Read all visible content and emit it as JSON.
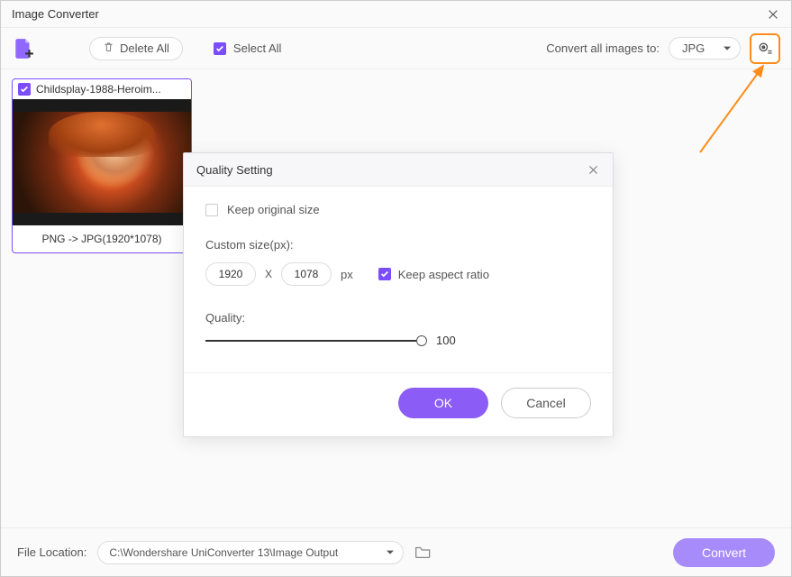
{
  "titlebar": {
    "title": "Image Converter"
  },
  "toolbar": {
    "delete_all_label": "Delete All",
    "select_all_label": "Select All",
    "convert_to_label": "Convert all images to:",
    "format_selected": "JPG"
  },
  "card": {
    "filename": "Childsplay-1988-Heroim...",
    "conversion_label": "PNG -> JPG(1920*1078)"
  },
  "modal": {
    "title": "Quality Setting",
    "keep_original_label": "Keep original size",
    "custom_size_label": "Custom size(px):",
    "width_value": "1920",
    "x_sep": "X",
    "height_value": "1078",
    "px_label": "px",
    "aspect_label": "Keep aspect ratio",
    "quality_label": "Quality:",
    "quality_value": "100",
    "ok_label": "OK",
    "cancel_label": "Cancel"
  },
  "footer": {
    "location_label": "File Location:",
    "location_path": "C:\\Wondershare UniConverter 13\\Image Output",
    "convert_label": "Convert"
  }
}
